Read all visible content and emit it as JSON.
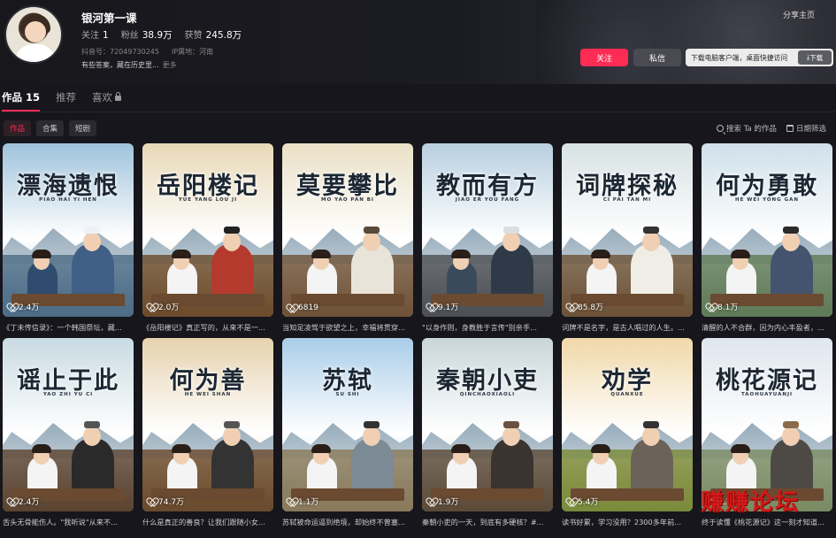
{
  "profile": {
    "name": "银河第一课",
    "follow_label": "关注",
    "follow_count": "1",
    "fans_label": "粉丝",
    "fans_count": "38.9万",
    "likes_label": "获赞",
    "likes_count": "245.8万",
    "douyin_id": "抖音号：72049730245",
    "ip": "IP属地：河南",
    "bio": "有些答案，藏在历史里...",
    "more": "更多"
  },
  "header": {
    "share": "分享主页",
    "follow_btn": "关注",
    "message_btn": "私信",
    "download_text": "下载电脑客户端，桌面快捷访问",
    "download_btn": "下载"
  },
  "tabs": [
    {
      "label": "作品",
      "count": "15"
    },
    {
      "label": "推荐"
    },
    {
      "label": "喜欢"
    }
  ],
  "chips": [
    "作品",
    "合集",
    "短剧"
  ],
  "search_label": "搜索 Ta 的作品",
  "date_filter": "日期筛选",
  "watermark": "赚赚论坛",
  "videos": [
    {
      "title": "漂海遗恨",
      "pinyin": "PIAO HAI YI HEN",
      "likes": "2.4万",
      "caption": "《丁未传信录》：一个韩国祭坛，藏...",
      "sky": "#9fc3dc",
      "ground": "#4d6c86"
    },
    {
      "title": "岳阳楼记",
      "pinyin": "YUE YANG LOU JI",
      "likes": "2.0万",
      "caption": "《岳阳楼记》真正写的，从来不是一...",
      "sky": "#e8d8b6",
      "ground": "#6b4b2c"
    },
    {
      "title": "莫要攀比",
      "pinyin": "MO YAO PAN BI",
      "likes": "6819",
      "caption": "当知足凌驾于欲望之上，幸福将贯穿...",
      "sky": "#e9e0c6",
      "ground": "#6e5238"
    },
    {
      "title": "教而有方",
      "pinyin": "JIAO ER YOU FANG",
      "likes": "9.1万",
      "caption": "\"以身作则，身教胜于言传\"别亲手...",
      "sky": "#b8cfe0",
      "ground": "#4c4f54"
    },
    {
      "title": "词牌探秘",
      "pinyin": "CI PAI TAN MI",
      "likes": "85.8万",
      "caption": "词牌不是名字，是古人唱过的人生。...",
      "sky": "#d8e2e4",
      "ground": "#6c5236"
    },
    {
      "title": "何为勇敢",
      "pinyin": "HE WEI YONG GAN",
      "likes": "8.1万",
      "caption": "清醒的人不合群，因为内心丰盈者，...",
      "sky": "#cfe0ea",
      "ground": "#5f7a56"
    },
    {
      "title": "谣止于此",
      "pinyin": "YAO ZHI YU CI",
      "likes": "2.4万",
      "caption": "舌头无骨能伤人。\"我听说\"从来不...",
      "sky": "#c8dbe2",
      "ground": "#5b4330"
    },
    {
      "title": "何为善",
      "pinyin": "HE WEI SHAN",
      "likes": "74.7万",
      "caption": "什么是真正的善良？让我们跟随小女...",
      "sky": "#e6d2ae",
      "ground": "#6a4a2c"
    },
    {
      "title": "苏轼",
      "pinyin": "SU SHI",
      "likes": "1.1万",
      "caption": "苏轼被命运逼到绝境，却始终不曾塞...",
      "sky": "#a9cde9",
      "ground": "#8a7a5a"
    },
    {
      "title": "秦朝小吏",
      "pinyin": "QINCHAOXIAOLI",
      "likes": "1.9万",
      "caption": "秦朝小吏的一天，到底有多硬核？#...",
      "sky": "#c9d6da",
      "ground": "#5c4a38"
    },
    {
      "title": "劝学",
      "pinyin": "QUANXUE",
      "likes": "5.4万",
      "caption": "读书好累，学习没用？2300多年前...",
      "sky": "#f0d8a8",
      "ground": "#7a8a3a"
    },
    {
      "title": "桃花源记",
      "pinyin": "TAOHUAYUANJI",
      "likes": "2.3万",
      "caption": "终于读懂《桃花源记》这一刻才知道...",
      "sky": "#dfe6ee",
      "ground": "#7a8a62"
    }
  ]
}
